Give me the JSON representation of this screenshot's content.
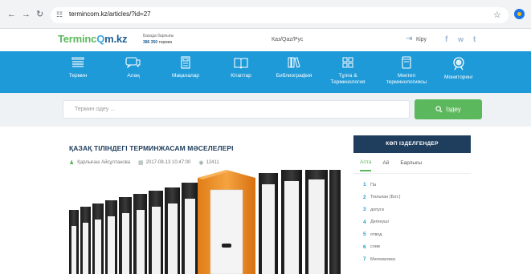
{
  "browser": {
    "url": "termincom.kz/articles/?id=27",
    "icons": [
      "back-icon",
      "forward-icon",
      "reload-icon",
      "site-info-icon",
      "star-icon",
      "profile-icon"
    ]
  },
  "header": {
    "logo_prefix": "Terminc",
    "logo_mid": "Q",
    "logo_suffix": "m.kz",
    "db_label": "Базада барлығы",
    "db_count": "386 350",
    "db_count_unit": "термин",
    "lang": "Каз/Qaz/Рус",
    "login": "Кіру",
    "social": [
      "f",
      "vk",
      "t"
    ]
  },
  "nav": {
    "items": [
      {
        "label": "Термин",
        "icon": "list-icon"
      },
      {
        "label": "Алаң",
        "icon": "chat-icon"
      },
      {
        "label": "Мақалалар",
        "icon": "document-icon"
      },
      {
        "label": "Кітаптар",
        "icon": "book-icon"
      },
      {
        "label": "Библиография",
        "icon": "library-icon"
      },
      {
        "label": "Тұлға &",
        "label2": "Терминология",
        "icon": "grid-icon"
      },
      {
        "label": "Мектеп",
        "label2": "терминологиясы",
        "icon": "notebook-icon"
      },
      {
        "label": "Мониторинг",
        "icon": "search-icon"
      }
    ]
  },
  "search": {
    "placeholder": "Термин іздеу ...",
    "button": "Іздеу"
  },
  "article": {
    "title": "ҚАЗАҚ ТІЛІНДЕГІ ТЕРМИНЖАСАМ МӘСЕЛЕЛЕРІ",
    "author": "Қарлығаш Айсұлтанова",
    "date": "2017-08-13 10:47:00",
    "views": "12411"
  },
  "sidebar": {
    "title": "КӨП ІЗДЕЛГЕНДЕР",
    "tabs": [
      "Апта",
      "Ай",
      "Барлығы"
    ],
    "active_tab": "Апта",
    "items": [
      {
        "num": "1",
        "text": "Па"
      },
      {
        "num": "2",
        "text": "Тюльпан (Бот.)"
      },
      {
        "num": "3",
        "text": "допуск"
      },
      {
        "num": "4",
        "text": "Дemeyші"
      },
      {
        "num": "5",
        "text": "отвод"
      },
      {
        "num": "6",
        "text": "слив"
      },
      {
        "num": "7",
        "text": "Математика"
      }
    ]
  },
  "colors": {
    "nav_blue": "#1f9ad8",
    "green": "#5cb85c",
    "dark_navy": "#1f3d5c",
    "binder_orange": "#f0962a"
  }
}
